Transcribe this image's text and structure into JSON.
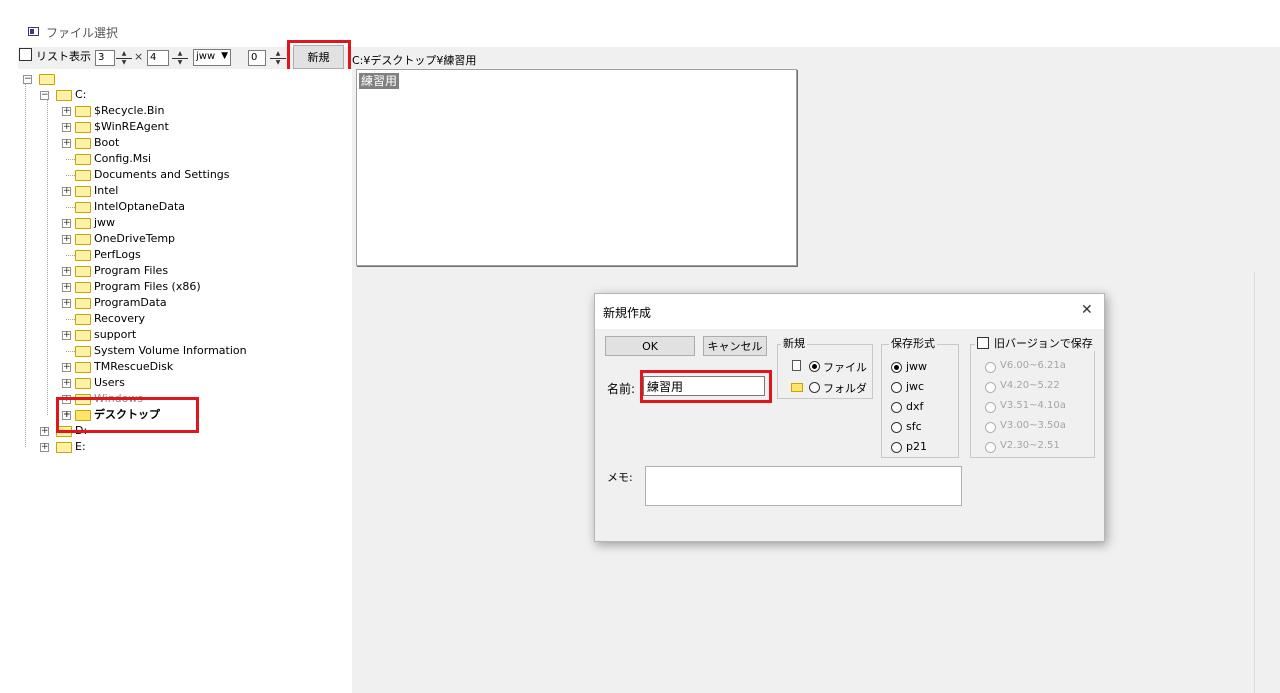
{
  "window": {
    "title": "ファイル選択"
  },
  "toolbar": {
    "list_view_label": "リスト表示",
    "cols_value": "3",
    "times_symbol": "×",
    "rows_value": "4",
    "ext_value": "jww",
    "num_value": "0",
    "new_button": "新規",
    "current_path": "C:¥デスクトップ¥練習用"
  },
  "tree": {
    "items": [
      {
        "label": "C:"
      },
      {
        "label": "$Recycle.Bin"
      },
      {
        "label": "$WinREAgent"
      },
      {
        "label": "Boot"
      },
      {
        "label": "Config.Msi"
      },
      {
        "label": "Documents and Settings"
      },
      {
        "label": "Intel"
      },
      {
        "label": "IntelOptaneData"
      },
      {
        "label": "jww"
      },
      {
        "label": "OneDriveTemp"
      },
      {
        "label": "PerfLogs"
      },
      {
        "label": "Program Files"
      },
      {
        "label": "Program Files (x86)"
      },
      {
        "label": "ProgramData"
      },
      {
        "label": "Recovery"
      },
      {
        "label": "support"
      },
      {
        "label": "System Volume Information"
      },
      {
        "label": "TMRescueDisk"
      },
      {
        "label": "Users"
      },
      {
        "label": "Windows"
      },
      {
        "label": "デスクトップ"
      },
      {
        "label": "D:"
      },
      {
        "label": "E:"
      }
    ]
  },
  "preview": {
    "folder_tag": "練習用"
  },
  "dialog": {
    "title": "新規作成",
    "close_symbol": "✕",
    "ok_button": "OK",
    "cancel_button": "キャンセル",
    "name_label": "名前:",
    "name_value": "練習用",
    "memo_label": "メモ:",
    "new_group": {
      "label": "新規",
      "file": "ファイル",
      "folder": "フォルダ"
    },
    "format_group": {
      "label": "保存形式",
      "options": [
        "jww",
        "jwc",
        "dxf",
        "sfc",
        "p21"
      ]
    },
    "old_version_group": {
      "label": "旧バージョンで保存",
      "options": [
        "V6.00~6.21a",
        "V4.20~5.22",
        "V3.51~4.10a",
        "V3.00~3.50a",
        "V2.30~2.51"
      ]
    }
  },
  "colors": {
    "highlight": "#e0161e",
    "folder": "#fff1a6",
    "preview_tag_bg": "#808080"
  }
}
